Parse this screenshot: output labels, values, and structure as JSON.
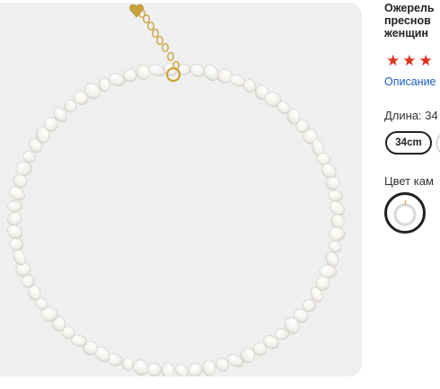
{
  "product": {
    "title_lines": [
      "Ожерель",
      "преснов",
      "женщин"
    ],
    "rating_stars": 3,
    "description_link": "Описание",
    "length": {
      "label": "Длина: 34",
      "selected_option": "34cm"
    },
    "color": {
      "label": "Цвет кам",
      "selected_swatch_icon": "pearl-necklace-thumbnail"
    }
  },
  "gallery": {
    "image_subject": "pearl-necklace-image",
    "background": "#efefef"
  },
  "colors": {
    "star": "#e0301e",
    "link": "#1a5fc7",
    "selected_border": "#222222",
    "clasp_gold": "#c9a23a"
  }
}
